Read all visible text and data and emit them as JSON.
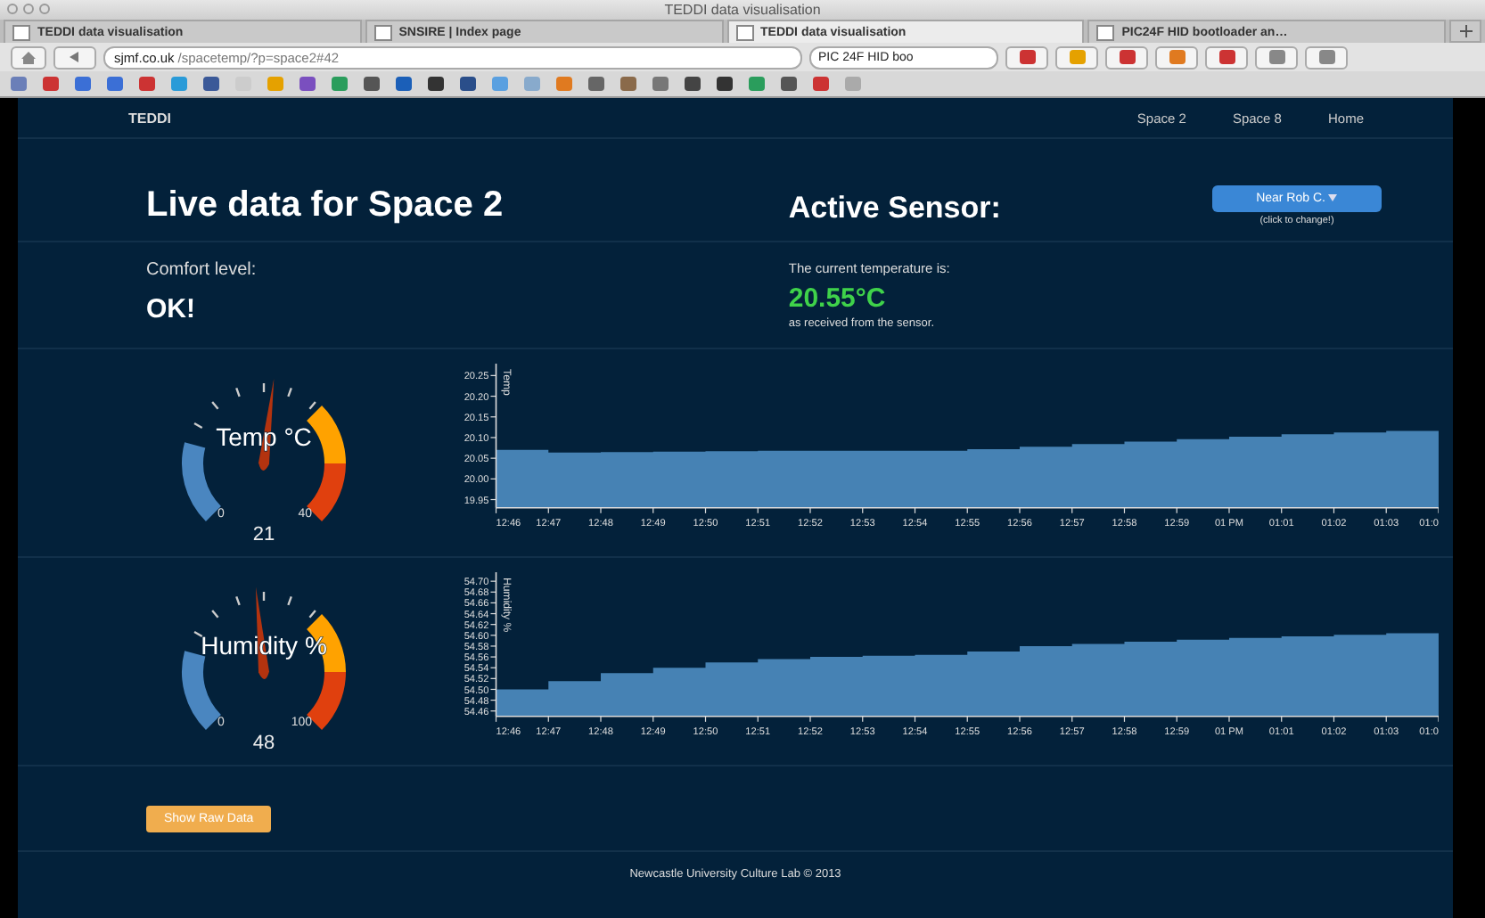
{
  "browser": {
    "window_title": "TEDDI data visualisation",
    "tabs": [
      {
        "label": "TEDDI data visualisation",
        "selected": false
      },
      {
        "label": "SNSIRE | Index page",
        "selected": false
      },
      {
        "label": "TEDDI data visualisation",
        "selected": true
      },
      {
        "label": "PIC24F HID bootloader an…",
        "selected": false
      }
    ],
    "url_host": "sjmf.co.uk",
    "url_path": "/spacetemp/?p=space2#42",
    "search_value": "PIC 24F HID boo"
  },
  "navbar": {
    "brand": "TEDDI",
    "links": [
      "Space 2",
      "Space 8",
      "Home"
    ]
  },
  "header": {
    "title": "Live data for Space 2",
    "sensor_label": "Active Sensor:",
    "sensor_button": "Near Rob C.",
    "sensor_hint": "(click to change!)"
  },
  "comfort": {
    "label": "Comfort level:",
    "value": "OK!"
  },
  "temperature": {
    "label": "The current temperature is:",
    "value": "20.55°C",
    "note": "as received from the sensor."
  },
  "sensors": [
    {
      "title": "Temp °C",
      "min": "0",
      "max": "40",
      "reading": "21",
      "chart_data": {
        "type": "area",
        "ylabel": "Temp",
        "categories": [
          "12:46",
          "12:47",
          "12:48",
          "12:49",
          "12:50",
          "12:51",
          "12:52",
          "12:53",
          "12:54",
          "12:55",
          "12:56",
          "12:57",
          "12:58",
          "12:59",
          "01 PM",
          "01:01",
          "01:02",
          "01:03",
          "01:0"
        ],
        "ylim": [
          19.93,
          20.27
        ],
        "yticks": [
          {
            "value": 19.95,
            "label": "19.95"
          },
          {
            "value": 20.0,
            "label": "20.00"
          },
          {
            "value": 20.05,
            "label": "20.05"
          },
          {
            "value": 20.1,
            "label": "20.10"
          },
          {
            "value": 20.15,
            "label": "20.15"
          },
          {
            "value": 20.2,
            "label": "20.20"
          },
          {
            "value": 20.25,
            "label": "20.25"
          }
        ],
        "series": [
          {
            "color": "#4682b4",
            "values": [
              20.07,
              20.064,
              20.065,
              20.066,
              20.067,
              20.068,
              20.068,
              20.068,
              20.068,
              20.072,
              20.078,
              20.084,
              20.09,
              20.096,
              20.102,
              20.108,
              20.112,
              20.116,
              20.12
            ]
          }
        ]
      }
    },
    {
      "title": "Humidity %",
      "min": "0",
      "max": "100",
      "reading": "48",
      "chart_data": {
        "type": "area",
        "ylabel": "Humidity %",
        "categories": [
          "12:46",
          "12:47",
          "12:48",
          "12:49",
          "12:50",
          "12:51",
          "12:52",
          "12:53",
          "12:54",
          "12:55",
          "12:56",
          "12:57",
          "12:58",
          "12:59",
          "01 PM",
          "01:01",
          "01:02",
          "01:03",
          "01:0"
        ],
        "ylim": [
          54.45,
          54.71
        ],
        "yticks": [
          {
            "value": 54.46,
            "label": "54.46"
          },
          {
            "value": 54.48,
            "label": "54.48"
          },
          {
            "value": 54.5,
            "label": "54.50"
          },
          {
            "value": 54.52,
            "label": "54.52"
          },
          {
            "value": 54.54,
            "label": "54.54"
          },
          {
            "value": 54.56,
            "label": "54.56"
          },
          {
            "value": 54.58,
            "label": "54.58"
          },
          {
            "value": 54.6,
            "label": "54.60"
          },
          {
            "value": 54.62,
            "label": "54.62"
          },
          {
            "value": 54.64,
            "label": "54.64"
          },
          {
            "value": 54.66,
            "label": "54.66"
          },
          {
            "value": 54.68,
            "label": "54.68"
          },
          {
            "value": 54.7,
            "label": "54.70"
          }
        ],
        "series": [
          {
            "color": "#4682b4",
            "values": [
              54.5,
              54.515,
              54.53,
              54.54,
              54.55,
              54.556,
              54.56,
              54.562,
              54.564,
              54.57,
              54.58,
              54.584,
              54.588,
              54.592,
              54.595,
              54.598,
              54.601,
              54.604,
              54.607
            ]
          }
        ]
      }
    }
  ],
  "raw_data_button": "Show Raw Data",
  "footer": "Newcastle University Culture Lab © 2013"
}
